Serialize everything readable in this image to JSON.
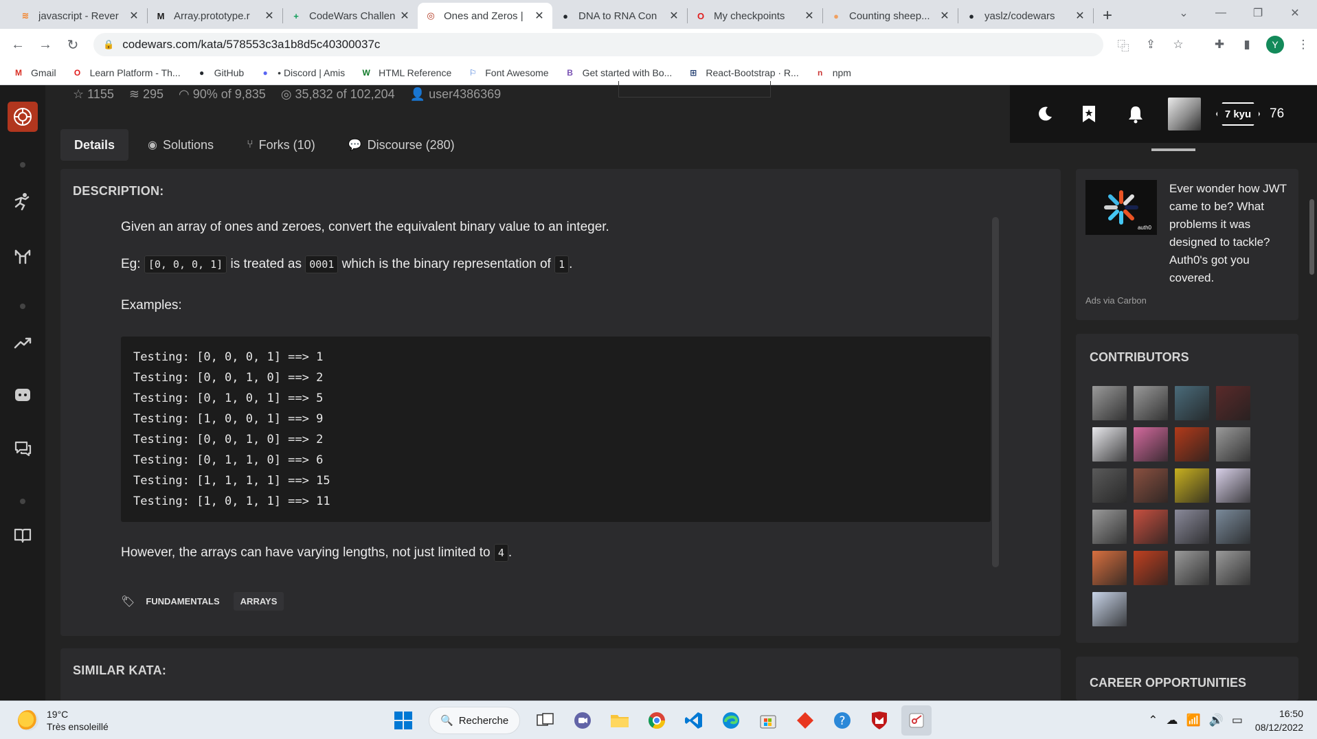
{
  "browser": {
    "tabs": [
      {
        "title": "javascript - Rever",
        "icon": "stackoverflow-icon",
        "color": "#f48024",
        "glyph": "≋"
      },
      {
        "title": "Array.prototype.r",
        "icon": "mdn-icon",
        "color": "#1b1b1b",
        "glyph": "M"
      },
      {
        "title": "CodeWars Challen",
        "icon": "sheets-icon",
        "color": "#0f9d58",
        "glyph": "+"
      },
      {
        "title": "Ones and Zeros |",
        "icon": "codewars-icon",
        "color": "#b1361e",
        "glyph": "◎",
        "active": true
      },
      {
        "title": "DNA to RNA Con",
        "icon": "github-icon",
        "color": "#24292e",
        "glyph": "●"
      },
      {
        "title": "My checkpoints",
        "icon": "openclassrooms-icon",
        "color": "#e01e1e",
        "glyph": "O"
      },
      {
        "title": "Counting sheep...",
        "icon": "codewars-sheep-icon",
        "color": "#f0a060",
        "glyph": "●"
      },
      {
        "title": "yaslz/codewars",
        "icon": "github-icon",
        "color": "#24292e",
        "glyph": "●"
      }
    ],
    "url": "codewars.com/kata/578553c3a1b8d5c40300037c",
    "profile_initial": "Y",
    "bookmarks": [
      {
        "label": "Gmail",
        "icon": "gmail-icon",
        "color": "#d93025",
        "glyph": "M"
      },
      {
        "label": "Learn Platform - Th...",
        "icon": "openclassrooms-icon",
        "color": "#e01e1e",
        "glyph": "O"
      },
      {
        "label": "GitHub",
        "icon": "github-icon",
        "color": "#24292e",
        "glyph": "●"
      },
      {
        "label": "• Discord | Amis",
        "icon": "discord-icon",
        "color": "#5865f2",
        "glyph": "●"
      },
      {
        "label": "HTML Reference",
        "icon": "w3-icon",
        "color": "#117a29",
        "glyph": "W"
      },
      {
        "label": "Font Awesome",
        "icon": "fontawesome-icon",
        "color": "#2c6cd6",
        "glyph": "⚐"
      },
      {
        "label": "Get started with Bo...",
        "icon": "bootstrap-icon",
        "color": "#7952b3",
        "glyph": "B"
      },
      {
        "label": "React-Bootstrap · R...",
        "icon": "react-bootstrap-icon",
        "color": "#1e3a6e",
        "glyph": "⊞"
      },
      {
        "label": "npm",
        "icon": "npm-icon",
        "color": "#cb3837",
        "glyph": "n"
      }
    ]
  },
  "kata": {
    "stats": {
      "stars": "1155",
      "collections": "295",
      "satisfaction": "90% of 9,835",
      "completed": "35,832 of 102,204",
      "author": "user4386369"
    },
    "tabs": [
      "Details",
      "Solutions",
      "Forks (10)",
      "Discourse (280)"
    ],
    "description_heading": "DESCRIPTION:",
    "intro": "Given an array of ones and zeroes, convert the equivalent binary value to an integer.",
    "eg_prefix": "Eg:",
    "eg_code_1": "[0, 0, 0, 1]",
    "eg_mid_1": "is treated as",
    "eg_code_2": "0001",
    "eg_mid_2": "which is the binary representation of",
    "eg_code_3": "1",
    "eg_suffix": ".",
    "examples_label": "Examples:",
    "code_lines": [
      "Testing: [0, 0, 0, 1] ==> 1",
      "Testing: [0, 0, 1, 0] ==> 2",
      "Testing: [0, 1, 0, 1] ==> 5",
      "Testing: [1, 0, 0, 1] ==> 9",
      "Testing: [0, 0, 1, 0] ==> 2",
      "Testing: [0, 1, 1, 0] ==> 6",
      "Testing: [1, 1, 1, 1] ==> 15",
      "Testing: [1, 0, 1, 1] ==> 11"
    ],
    "outro_text": "However, the arrays can have varying lengths, not just limited to",
    "outro_code": "4",
    "outro_suffix": ".",
    "tags": [
      "FUNDAMENTALS",
      "ARRAYS"
    ],
    "similar_heading": "SIMILAR KATA:"
  },
  "header": {
    "rank": "7 kyu",
    "honor": "76"
  },
  "ad": {
    "text": "Ever wonder how JWT came to be? What problems it was designed to tackle? Auth0's got you covered.",
    "via": "Ads via Carbon",
    "brand": "auth0"
  },
  "contributors": {
    "heading": "CONTRIBUTORS",
    "avatars": [
      "#9a9a9a",
      "#9a9a9a",
      "#4a6b7a",
      "#5a2a2a",
      "#e8e8ec",
      "#d46a9e",
      "#b23a1a",
      "#9a9a9a",
      "#5a5a5a",
      "#8a5040",
      "#c8b020",
      "#d8d0e8",
      "#9a9a9a",
      "#c85040",
      "#8a8a9a",
      "#7a8a9a",
      "#d87040",
      "#c04020",
      "#9a9a9a",
      "#9a9a9a",
      "#c8d4e8"
    ]
  },
  "career_heading": "CAREER OPPORTUNITIES",
  "taskbar": {
    "temp": "19°C",
    "weather": "Très ensoleillé",
    "search": "Recherche",
    "time": "16:50",
    "date": "08/12/2022"
  }
}
